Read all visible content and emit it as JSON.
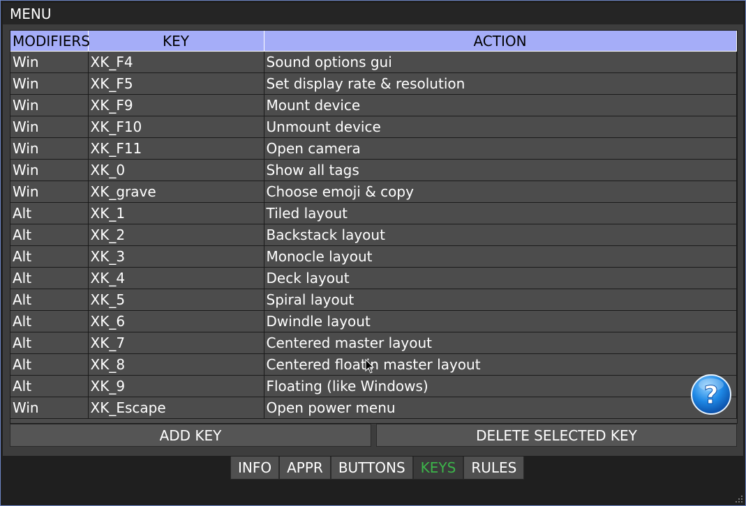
{
  "window": {
    "title": "MENU"
  },
  "table": {
    "headers": {
      "modifiers": "MODIFIERS",
      "key": "KEY",
      "action": "ACTION"
    },
    "rows": [
      {
        "modifiers": "Win",
        "key": "XK_F4",
        "action": "Sound options gui"
      },
      {
        "modifiers": "Win",
        "key": "XK_F5",
        "action": "Set display rate & resolution"
      },
      {
        "modifiers": "Win",
        "key": "XK_F9",
        "action": "Mount device"
      },
      {
        "modifiers": "Win",
        "key": "XK_F10",
        "action": "Unmount device"
      },
      {
        "modifiers": "Win",
        "key": "XK_F11",
        "action": "Open camera"
      },
      {
        "modifiers": "Win",
        "key": "XK_0",
        "action": "Show all tags"
      },
      {
        "modifiers": "Win",
        "key": "XK_grave",
        "action": "Choose emoji & copy"
      },
      {
        "modifiers": "Alt",
        "key": "XK_1",
        "action": "Tiled layout"
      },
      {
        "modifiers": "Alt",
        "key": "XK_2",
        "action": "Backstack layout"
      },
      {
        "modifiers": "Alt",
        "key": "XK_3",
        "action": "Monocle layout"
      },
      {
        "modifiers": "Alt",
        "key": "XK_4",
        "action": "Deck layout"
      },
      {
        "modifiers": "Alt",
        "key": "XK_5",
        "action": "Spiral layout"
      },
      {
        "modifiers": "Alt",
        "key": "XK_6",
        "action": "Dwindle layout"
      },
      {
        "modifiers": "Alt",
        "key": "XK_7",
        "action": "Centered master layout"
      },
      {
        "modifiers": "Alt",
        "key": "XK_8",
        "action": "Centered floatin master layout"
      },
      {
        "modifiers": "Alt",
        "key": "XK_9",
        "action": "Floating (like Windows)"
      },
      {
        "modifiers": "Win",
        "key": "XK_Escape",
        "action": "Open power menu"
      }
    ]
  },
  "buttons": {
    "add": "ADD KEY",
    "delete": "DELETE SELECTED KEY"
  },
  "tabs": [
    {
      "label": "INFO"
    },
    {
      "label": "APPR"
    },
    {
      "label": "BUTTONS"
    },
    {
      "label": "KEYS"
    },
    {
      "label": "RULES"
    }
  ],
  "active_tab": "KEYS",
  "help": {
    "icon": "help-icon",
    "glyph": "?"
  },
  "colors": {
    "header": "#a5adf8",
    "active_tab_text": "#3cb54a",
    "help_blue": "#1e88e5",
    "window_border": "#6f87c8"
  }
}
